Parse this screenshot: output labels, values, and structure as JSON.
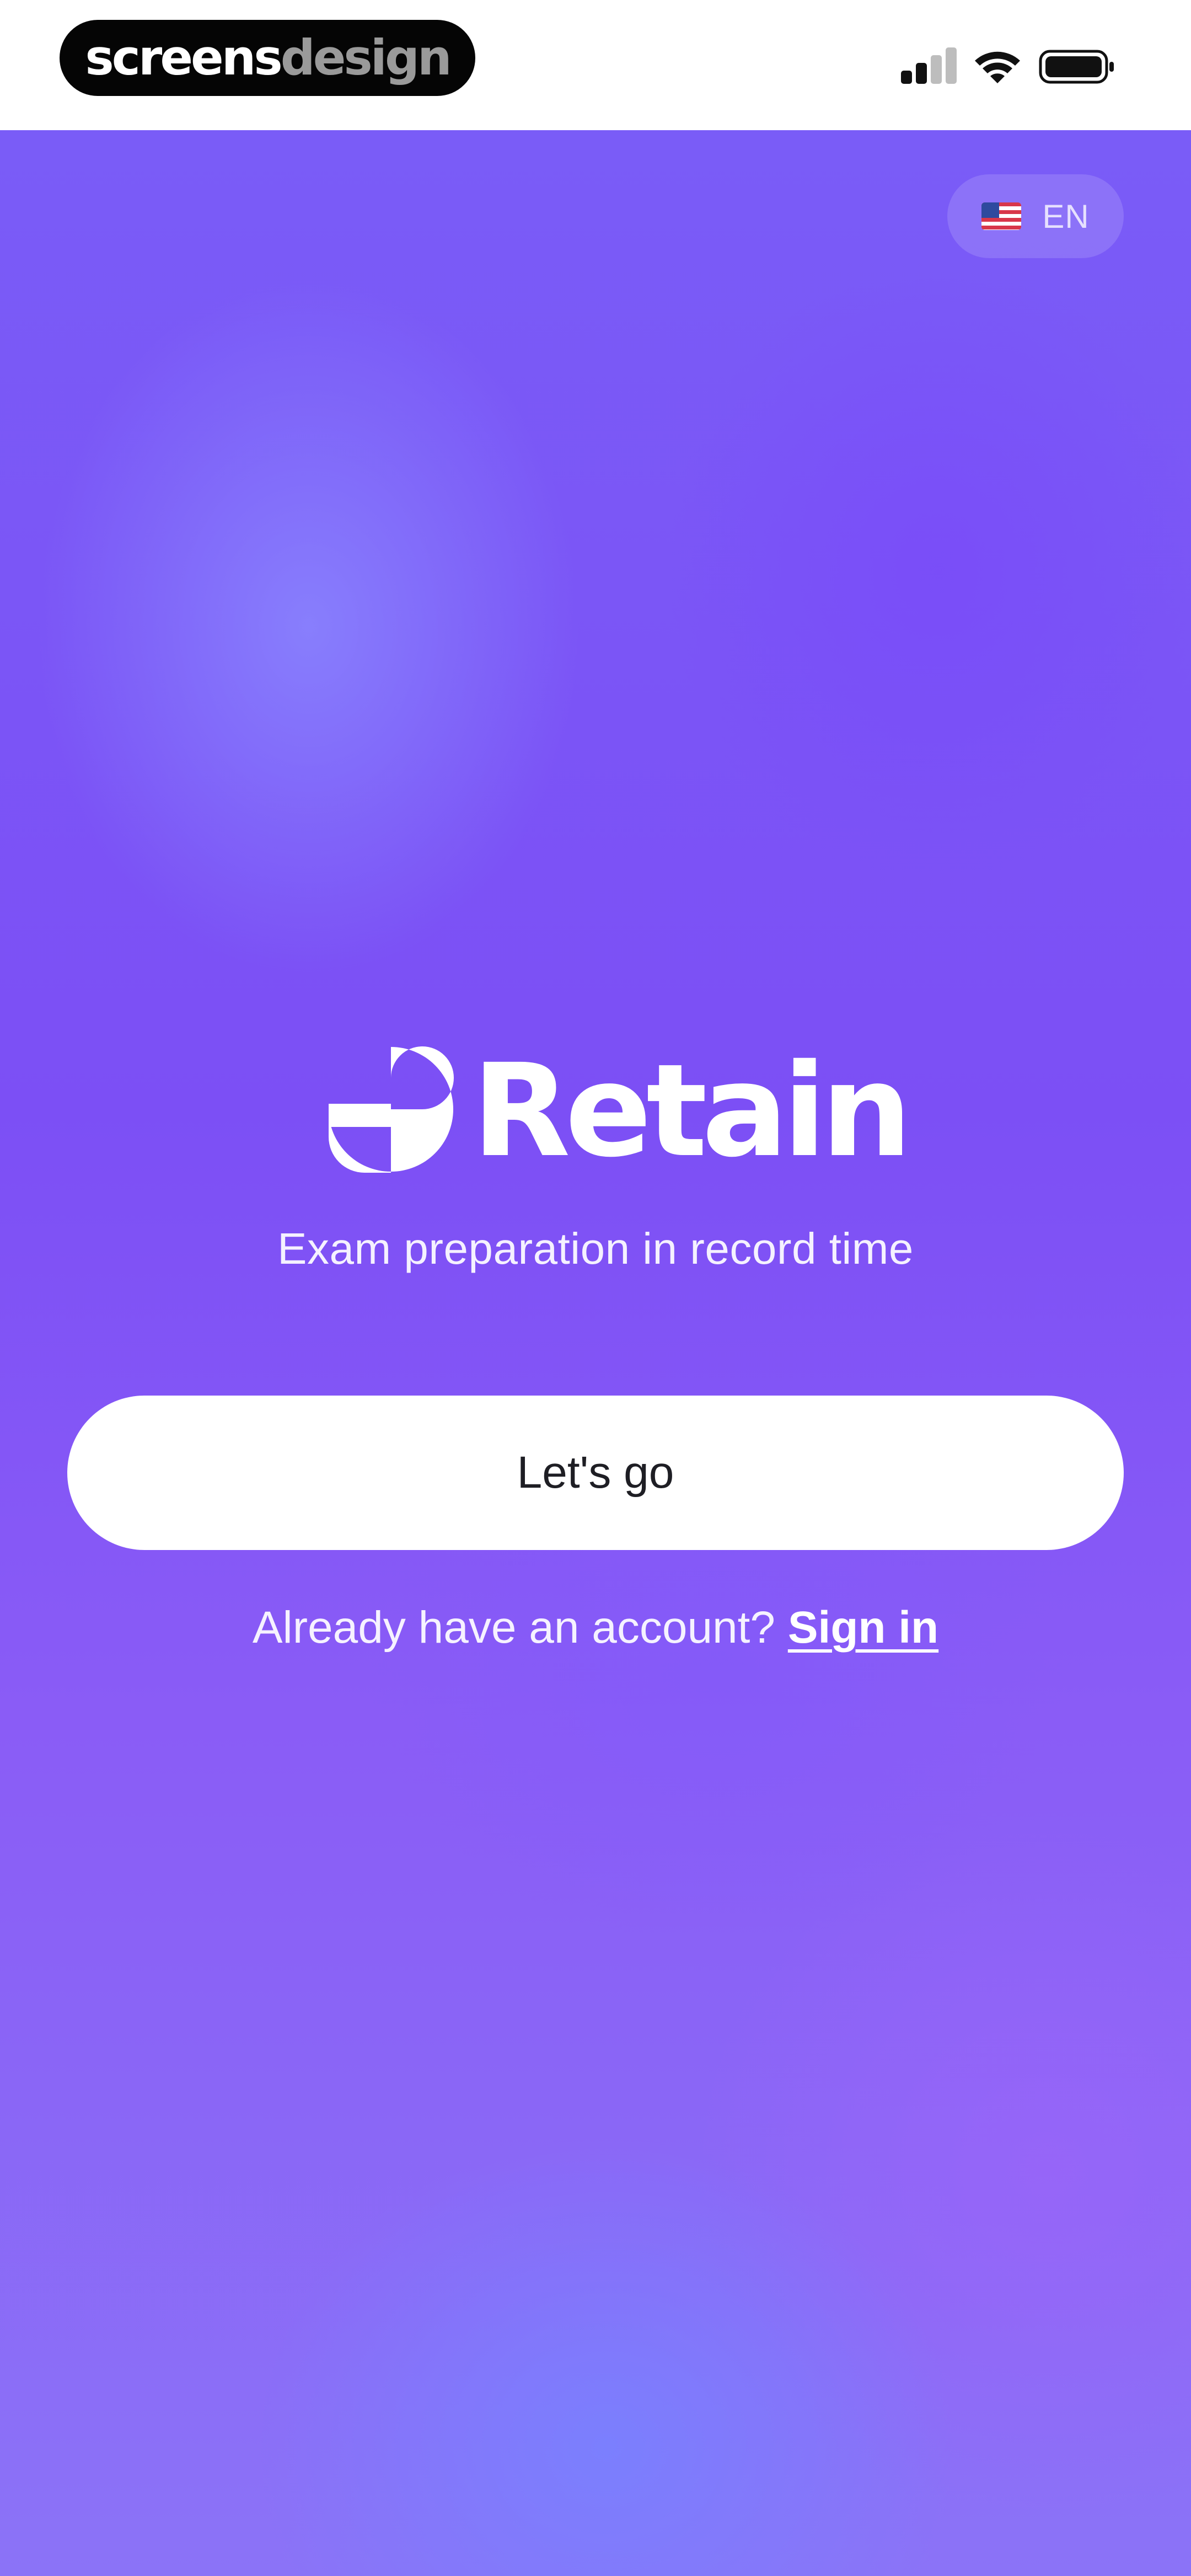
{
  "status_bar": {
    "watermark_part1": "screens",
    "watermark_part2": "design",
    "icons": [
      "signal-icon",
      "wifi-icon",
      "battery-icon"
    ]
  },
  "language": {
    "flag": "us-flag-icon",
    "code": "EN"
  },
  "brand": {
    "name": "Retain",
    "tagline": "Exam preparation in record time"
  },
  "actions": {
    "primary_label": "Let's go",
    "account_prompt": "Already have an account?",
    "signin_label": "Sign in"
  },
  "colors": {
    "background_primary": "#7b55f5",
    "button_bg": "#ffffff",
    "button_text": "#1e1e24"
  }
}
